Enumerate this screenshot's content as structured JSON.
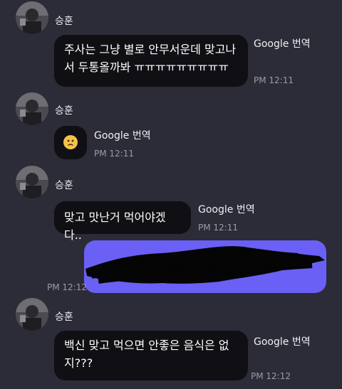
{
  "messages": [
    {
      "sender": "승훈",
      "text_lines": [
        "주사는 그냥 별로 안무서운데 맞고나",
        "서 두통올까봐 ㅠㅠㅠㅠㅠㅠㅠㅠㅠ"
      ],
      "translate_label": "Google 번역",
      "time": "PM 12:11"
    },
    {
      "sender": "승훈",
      "emoji": "slightly-frowning-face",
      "translate_label": "Google 번역",
      "time": "PM 12:11"
    },
    {
      "sender": "승훈",
      "text_lines": [
        "맞고 맛난거 먹어야겠다.."
      ],
      "translate_label": "Google 번역",
      "time": "PM 12:11"
    },
    {
      "sent": true,
      "time": "PM 12:12"
    },
    {
      "sender": "승훈",
      "text_lines": [
        "백신 맞고 먹으면 안좋은 음식은 없",
        "지???"
      ],
      "translate_label": "Google 번역",
      "time": "PM 12:12"
    }
  ],
  "colors": {
    "background": "#2c2b38",
    "received_bubble": "#0f0f14",
    "sent_bubble": "#6a60f5",
    "time_text": "#9c9ba8"
  }
}
